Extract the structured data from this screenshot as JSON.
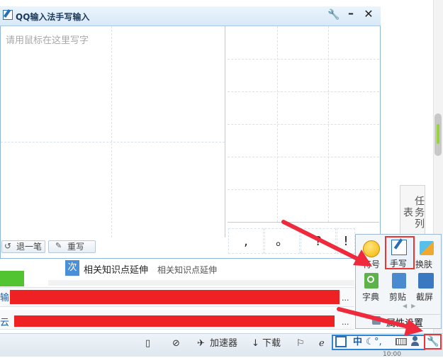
{
  "handwriting_window": {
    "title": "QQ输入法手写输入",
    "placeholder": "请用鼠标在这里写字",
    "undo_label": "退一笔",
    "rewrite_label": "重写",
    "punctuation": [
      ",",
      "。",
      "?",
      "!"
    ]
  },
  "side_tab": {
    "label": "任务列表"
  },
  "page": {
    "related_badge": "次",
    "related_title": "相关知识点延伸",
    "related_sub": "相关知识点延伸",
    "row1_prefix": "输入",
    "row2_prefix": "云",
    "ellipsis": "..."
  },
  "popup": {
    "items": [
      {
        "label": "符号",
        "icon": "emoji-icon"
      },
      {
        "label": "手写",
        "icon": "handwriting-icon"
      },
      {
        "label": "换肤",
        "icon": "skin-icon"
      },
      {
        "label": "字典",
        "icon": "dictionary-icon"
      },
      {
        "label": "剪贴",
        "icon": "clipboard-icon"
      },
      {
        "label": "截屏",
        "icon": "screenshot-icon"
      }
    ],
    "settings_label": "属性设置"
  },
  "taskbar": {
    "accelerator_label": "加速器",
    "download_label": "下载",
    "ime_mode": "中",
    "ime_punct": "°,",
    "clock": "10:00"
  },
  "colors": {
    "highlight_red": "#ee2222",
    "accent_blue": "#2f86d6",
    "green": "#53c431"
  }
}
